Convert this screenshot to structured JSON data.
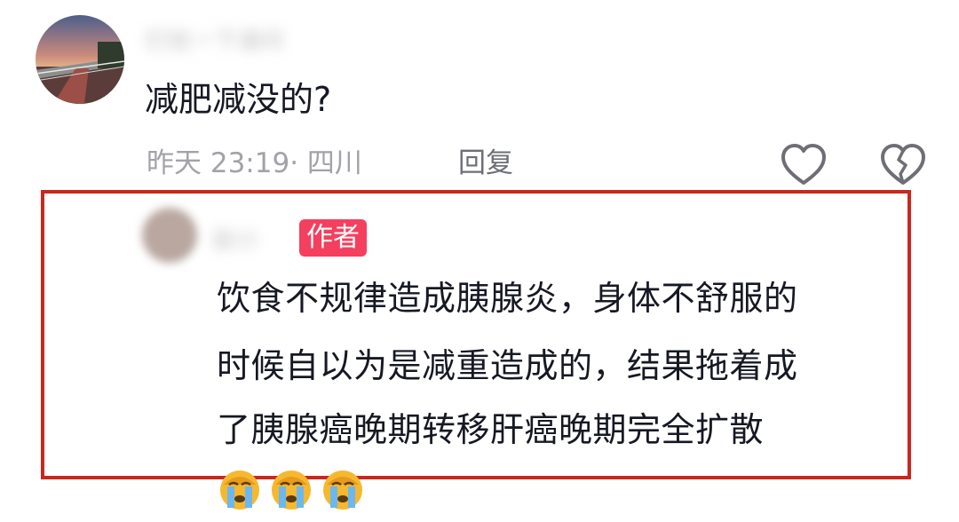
{
  "top_comment": {
    "username": "打扰一下请问",
    "text": "减肥减没的?",
    "meta": "昨天 23:19· 四川",
    "reply_label": "回复"
  },
  "author_reply": {
    "username": "赵小",
    "badge": "作者",
    "lines": [
      "饮食不规律造成胰腺炎，身体不舒服的",
      "时候自以为是减重造成的，结果拖着成",
      "了胰腺癌晚期转移肝癌晚期完全扩散"
    ],
    "emojis": [
      "crying-face",
      "crying-face",
      "crying-face"
    ]
  },
  "colors": {
    "highlight_border": "#c8281e",
    "badge_bg": "#f43f5e",
    "text_primary": "#161823",
    "text_secondary": "#a2a3a8"
  },
  "icons": {
    "like": "heart-icon",
    "dislike": "broken-heart-icon"
  }
}
